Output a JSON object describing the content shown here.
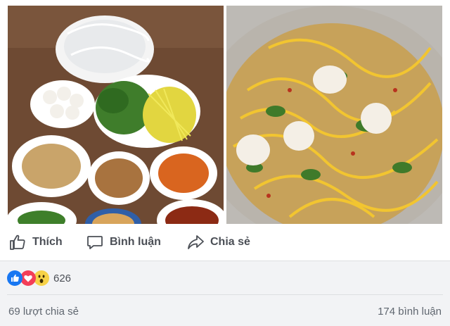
{
  "post": {
    "photos": [
      {
        "alt": "left-photo"
      },
      {
        "alt": "right-photo"
      }
    ]
  },
  "actions": {
    "like_label": "Thích",
    "comment_label": "Bình luận",
    "share_label": "Chia sẻ"
  },
  "reactions": {
    "icons": [
      "like-icon",
      "love-icon",
      "wow-icon"
    ],
    "count": "626"
  },
  "footer": {
    "shares": "69 lượt chia sẻ",
    "comments": "174 bình luận"
  },
  "colors": {
    "like": "#1877f2",
    "love": "#f33e58",
    "wow": "#f7d247",
    "band": "#f2f3f5"
  }
}
